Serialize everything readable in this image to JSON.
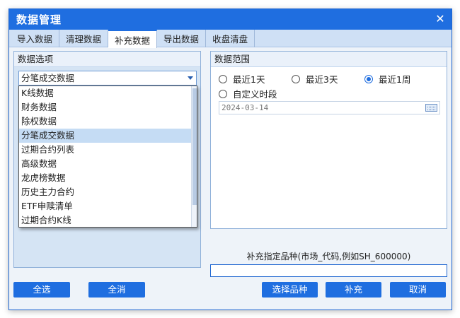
{
  "window": {
    "title": "数据管理"
  },
  "tabs": [
    "导入数据",
    "清理数据",
    "补充数据",
    "导出数据",
    "收盘清盘"
  ],
  "active_tab": "补充数据",
  "left": {
    "title": "数据选项",
    "combo_value": "分笔成交数据",
    "options": [
      "K线数据",
      "财务数据",
      "除权数据",
      "分笔成交数据",
      "过期合约列表",
      "高级数据",
      "龙虎榜数据",
      "历史主力合约",
      "ETF申赎清单",
      "过期合约K线"
    ],
    "selected_option": "分笔成交数据"
  },
  "right": {
    "title": "数据范围",
    "radios": [
      "最近1天",
      "最近3天",
      "最近1周",
      "自定义时段"
    ],
    "selected_radio": "最近1周",
    "date": "2024-03-14"
  },
  "hint": "补充指定品种(市场_代码,例如SH_600000)",
  "code_input": "",
  "buttons": {
    "select_all": "全选",
    "deselect_all": "全消",
    "choose_symbol": "选择品种",
    "supplement": "补充",
    "cancel": "取消"
  },
  "colors": {
    "accent": "#1f6ee0",
    "selection": "#c5dcf4",
    "panel": "#d5e4f4"
  }
}
